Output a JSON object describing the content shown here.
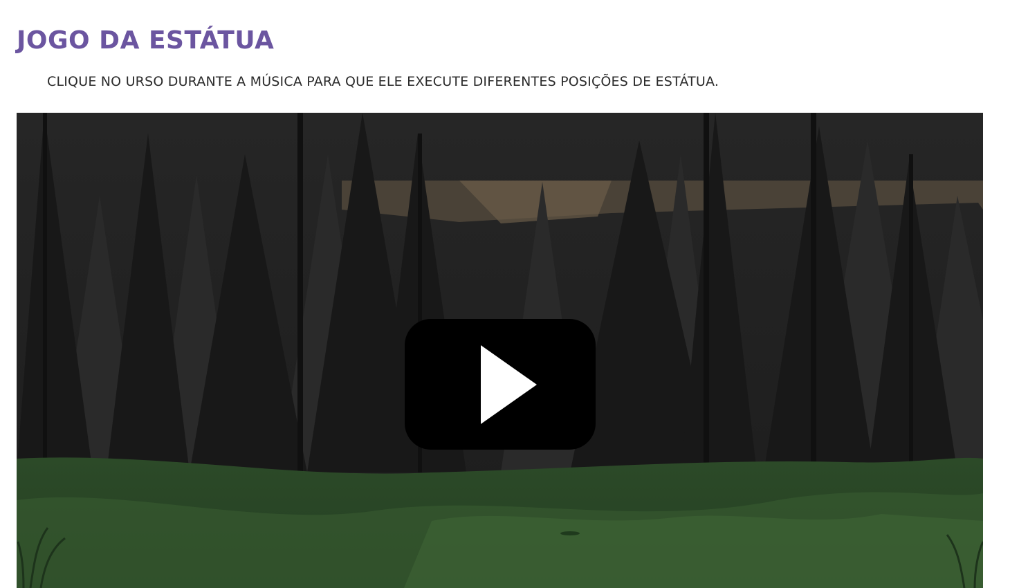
{
  "page": {
    "title": "JOGO DA ESTÁTUA",
    "instruction": "CLIQUE NO URSO DURANTE A MÚSICA PARA QUE ELE EXECUTE DIFERENTES POSIÇÕES DE ESTÁTUA."
  },
  "video": {
    "play_icon": "play-icon",
    "colors": {
      "title": "#6b55a0",
      "sky": "#1f1f1f",
      "trees": "#141414",
      "grass": "#2e4a2a",
      "play_button": "#000000"
    }
  }
}
